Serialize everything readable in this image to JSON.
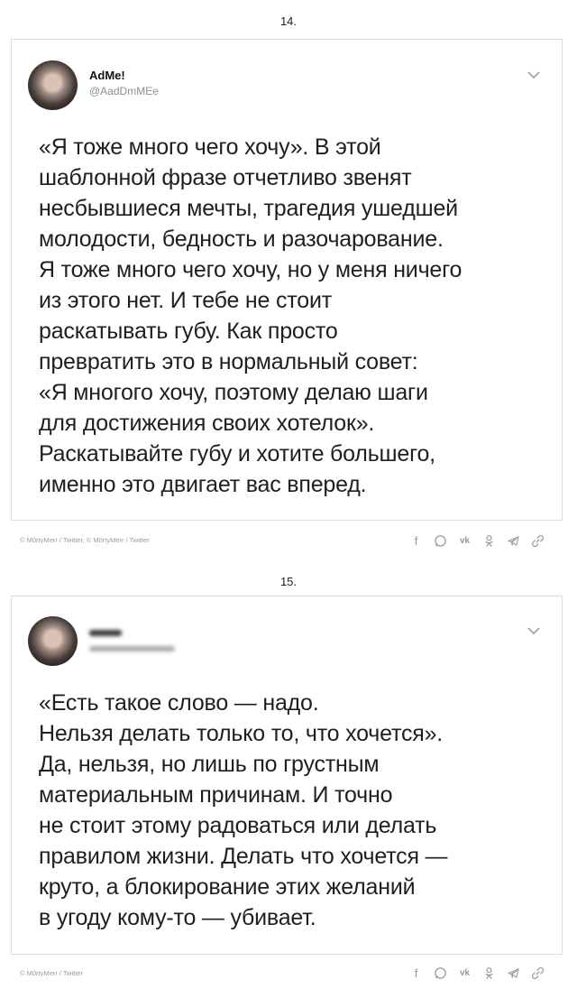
{
  "posts": [
    {
      "number": "14.",
      "username": "AdMe!",
      "handle": "@AadDmMEe",
      "text": "«Я тоже много чего хочу». В этой\nшаблонной фразе отчетливо звенят\nнесбывшиеся мечты, трагедия ушедшей\nмолодости, бедность и разочарование.\nЯ тоже много чего хочу, но у меня ничего\nиз этого нет. И тебе не стоит\nраскатывать губу. Как просто\nпревратить это в нормальный совет:\n«Я многого хочу, поэтому делаю шаги\nдля достижения своих хотелок».\nРаскатывайте губу и хотите большего,\nименно это двигает вас вперед.",
      "credit": "© M0rtyMerr / Twitter, © M0rtyMerr / Twitter"
    },
    {
      "number": "15.",
      "text": "«Есть такое слово — надо.\nНельзя делать только то, что хочется».\nДа, нельзя, но лишь по грустным\nматериальным причинам. И точно\nне стоит этому радоваться или делать\nправилом жизни. Делать что хочется —\nкруто, а блокирование этих желаний\nв угоду кому-то — убивает.",
      "credit": "© M0rtyMerr / Twitter"
    }
  ],
  "share_icons": {
    "facebook": "f",
    "vk": "vk",
    "colors": {
      "icon": "#9a9a9a",
      "border": "#dcdcdc"
    }
  }
}
